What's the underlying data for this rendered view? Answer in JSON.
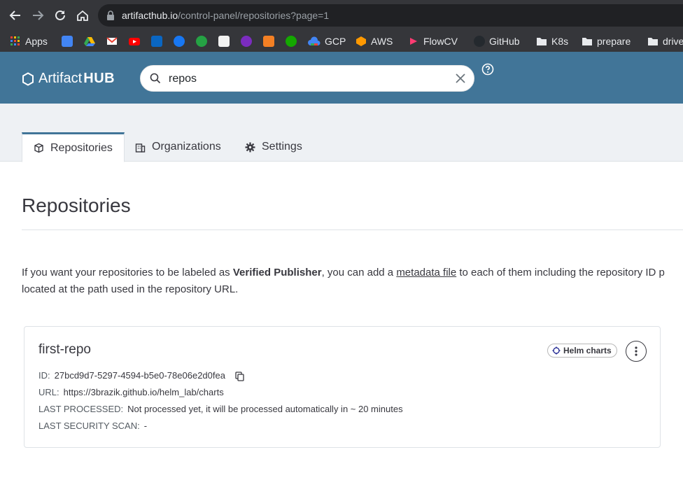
{
  "browser": {
    "url_host": "artifacthub.io",
    "url_path": "/control-panel/repositories?page=1"
  },
  "bookmarks": [
    {
      "label": "Apps",
      "icon": "apps-grid-icon"
    },
    {
      "label": "",
      "icon": "google-translate-icon"
    },
    {
      "label": "",
      "icon": "google-drive-icon"
    },
    {
      "label": "",
      "icon": "gmail-icon"
    },
    {
      "label": "",
      "icon": "youtube-icon"
    },
    {
      "label": "",
      "icon": "linkedin-icon"
    },
    {
      "label": "",
      "icon": "facebook-icon"
    },
    {
      "label": "",
      "icon": "badge-2-icon"
    },
    {
      "label": "",
      "icon": "notion-icon"
    },
    {
      "label": "",
      "icon": "purple-u-icon"
    },
    {
      "label": "",
      "icon": "stackoverflow-icon"
    },
    {
      "label": "",
      "icon": "upwork-icon"
    },
    {
      "label": "GCP",
      "icon": "gcp-icon"
    },
    {
      "label": "AWS",
      "icon": "aws-icon"
    },
    {
      "label": "FlowCV",
      "icon": "flowcv-icon"
    },
    {
      "label": "GitHub",
      "icon": "github-icon"
    },
    {
      "label": "K8s",
      "icon": "folder-icon"
    },
    {
      "label": "prepare",
      "icon": "folder-icon"
    },
    {
      "label": "drive",
      "icon": "folder-icon"
    }
  ],
  "header": {
    "logo_light": "Artifact",
    "logo_bold": "HUB",
    "search_value": "repos"
  },
  "tabs": [
    {
      "label": "Repositories",
      "active": true
    },
    {
      "label": "Organizations",
      "active": false
    },
    {
      "label": "Settings",
      "active": false
    }
  ],
  "main": {
    "title": "Repositories",
    "info_1": "If you want your repositories to be labeled as ",
    "info_bold": "Verified Publisher",
    "info_2": ", you can add a ",
    "info_link": "metadata file",
    "info_3": " to each of them including the repository ID p",
    "info_line2": "located at the path used in the repository URL."
  },
  "repo": {
    "name": "first-repo",
    "kind": "Helm charts",
    "id_label": "ID:",
    "id_value": "27bcd9d7-5297-4594-b5e0-78e06e2d0fea",
    "url_label": "URL:",
    "url_value": "https://3brazik.github.io/helm_lab/charts",
    "processed_label": "LAST PROCESSED:",
    "processed_value": "Not processed yet, it will be processed automatically in ~ 20 minutes",
    "scan_label": "LAST SECURITY SCAN:",
    "scan_value": "-"
  },
  "colors": {
    "nav_bg": "#417598",
    "chrome_bg": "#35363a",
    "tabs_bg": "#eef1f4",
    "text": "#38383f"
  }
}
